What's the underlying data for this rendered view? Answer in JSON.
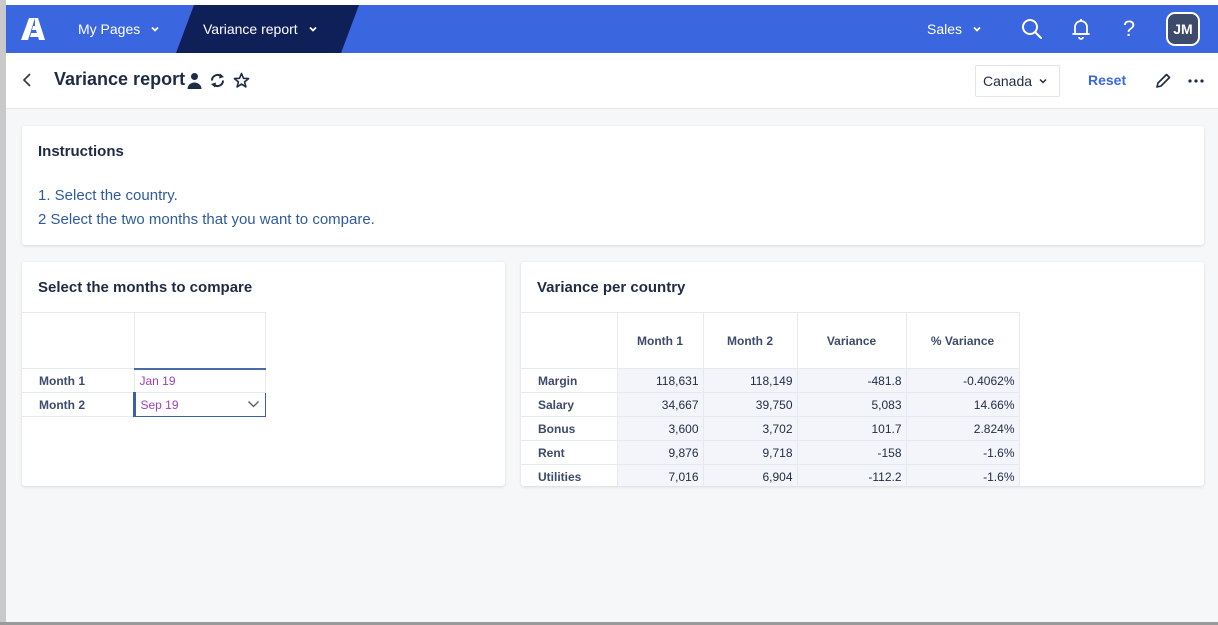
{
  "topnav": {
    "logo": "app-logo",
    "my_pages_label": "My Pages",
    "active_page_label": "Variance report",
    "workspace_label": "Sales",
    "avatar_initials": "JM",
    "help_glyph": "?",
    "brand_color": "#3a66e0",
    "active_tab_color": "#0f1f57"
  },
  "header": {
    "title": "Variance report",
    "country_selected": "Canada",
    "reset_label": "Reset"
  },
  "instructions": {
    "title": "Instructions",
    "lines": [
      "1. Select the country.",
      "2 Select the two months that you want to compare."
    ]
  },
  "months": {
    "title": "Select the months to compare",
    "rows": [
      {
        "label": "Month 1",
        "value": "Jan 19"
      },
      {
        "label": "Month 2",
        "value": "Sep 19"
      }
    ]
  },
  "variance": {
    "title": "Variance per country",
    "columns": [
      "",
      "Month 1",
      "Month 2",
      "Variance",
      "% Variance"
    ],
    "rows": [
      {
        "label": "Margin",
        "month1": "118,631",
        "month2": "118,149",
        "variance": "-481.8",
        "pct": "-0.4062%"
      },
      {
        "label": "Salary",
        "month1": "34,667",
        "month2": "39,750",
        "variance": "5,083",
        "pct": "14.66%"
      },
      {
        "label": "Bonus",
        "month1": "3,600",
        "month2": "3,702",
        "variance": "101.7",
        "pct": "2.824%"
      },
      {
        "label": "Rent",
        "month1": "9,876",
        "month2": "9,718",
        "variance": "-158",
        "pct": "-1.6%"
      },
      {
        "label": "Utilities",
        "month1": "7,016",
        "month2": "6,904",
        "variance": "-112.2",
        "pct": "-1.6%"
      }
    ]
  }
}
